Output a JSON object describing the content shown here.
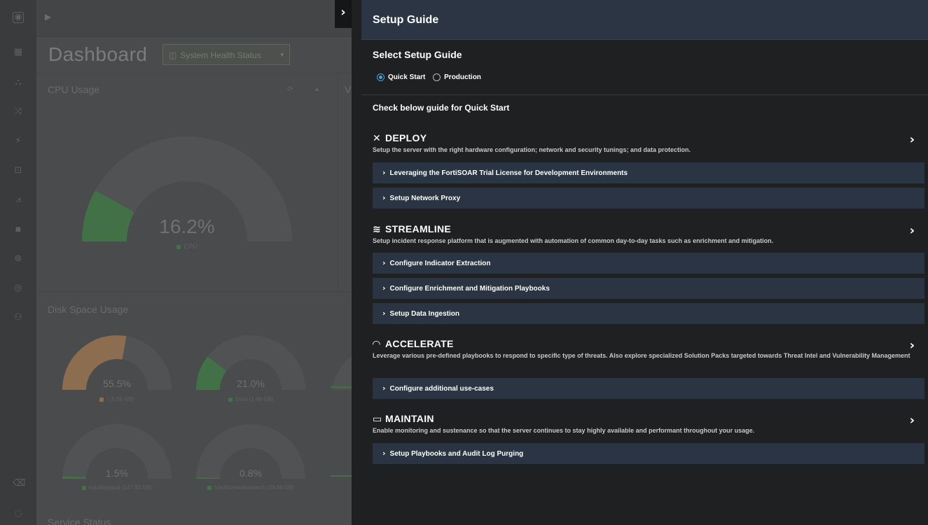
{
  "dashboard": {
    "title": "Dashboard",
    "dashboard_select": "System Health Status",
    "cpu_panel": {
      "label": "CPU Usage",
      "value": "16.2%",
      "legend": "CPU",
      "percent": 16.2
    },
    "extra_panel_label": "V",
    "disk_panel": {
      "label": "Disk Space Usage",
      "gauges": [
        {
          "value": "55.5%",
          "legend": "/ (5.99 GB)",
          "percent": 55.5,
          "color": "#8c6d4f"
        },
        {
          "value": "21.0%",
          "legend": "/boot (1.49 GB)",
          "percent": 21.0,
          "color": "#427047"
        },
        {
          "value": "1.5%",
          "legend": "/var/lib/pgsql (147.93 GB)",
          "percent": 1.5,
          "color": "#427047"
        },
        {
          "value": "0.8%",
          "legend": "/var/lib/elasticsearch (39.98 GB)",
          "percent": 0.8,
          "color": "#427047"
        }
      ]
    },
    "service_panel": {
      "label": "Service Status"
    }
  },
  "rail_icons": [
    "app-logo-icon",
    "dashboard-icon",
    "incidents-icon",
    "shuffle-icon",
    "lightning-icon",
    "briefcase-icon",
    "chart-icon",
    "apps-icon",
    "automation-icon",
    "support-icon",
    "users-icon",
    "trash-icon",
    "settings-icon"
  ],
  "guide": {
    "title": "Setup Guide",
    "select_title": "Select Setup Guide",
    "options": [
      {
        "label": "Quick Start",
        "selected": true
      },
      {
        "label": "Production",
        "selected": false
      }
    ],
    "check_title": "Check below guide for Quick Start",
    "sections": [
      {
        "title": "DEPLOY",
        "icon": "tools-icon",
        "description": "Setup the server with the right hardware configuration; network and security tunings; and data protection.",
        "items": [
          "Leveraging the FortiSOAR Trial License for Development Environments",
          "Setup Network Proxy"
        ]
      },
      {
        "title": "STREAMLINE",
        "icon": "layers-icon",
        "description": "Setup incident response platform that is augmented with automation of common day-to-day tasks such as enrichment and mitigation.",
        "items": [
          "Configure Indicator Extraction",
          "Configure Enrichment and Mitigation Playbooks",
          "Setup Data Ingestion"
        ]
      },
      {
        "title": "ACCELERATE",
        "icon": "speedometer-icon",
        "description": "Leverage various pre-defined playbooks to respond to specific type of threats. Also explore specialized Solution Packs targeted towards Threat Intel and Vulnerability Management",
        "items": [
          "Configure additional use-cases"
        ]
      },
      {
        "title": "MAINTAIN",
        "icon": "monitor-icon",
        "description": "Enable monitoring and sustenance so that the server continues to stay highly available and performant throughout your usage.",
        "items": [
          "Setup Playbooks and Audit Log Purging"
        ]
      }
    ]
  },
  "colors": {
    "accent": "#3ea6e0",
    "header": "#2b3543",
    "item": "#2a3442",
    "gauge_green": "#427047",
    "gauge_orange": "#8c6d4f"
  }
}
